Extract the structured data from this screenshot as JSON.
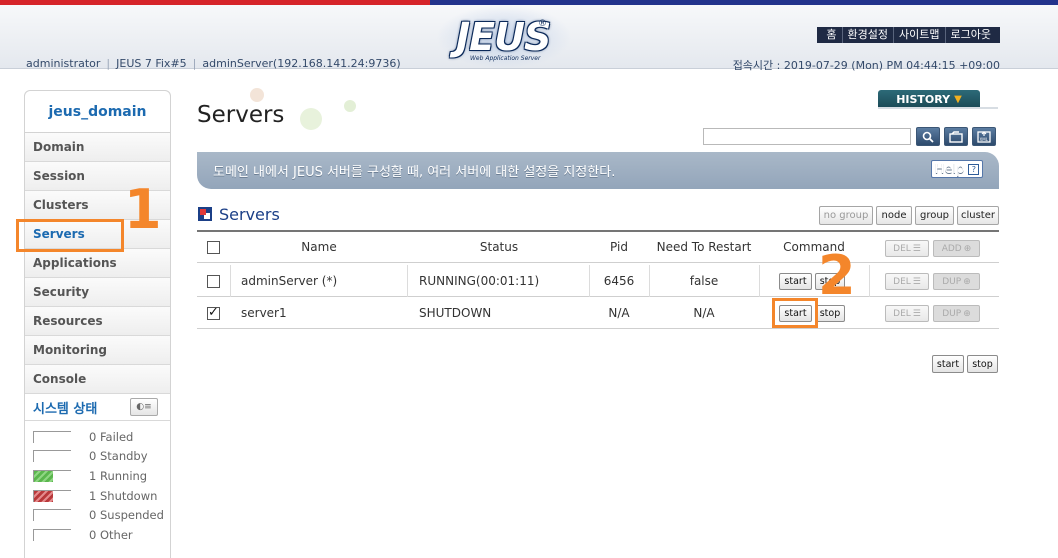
{
  "header": {
    "logo": "JEUS",
    "logo_subtitle": "Web Application Server",
    "nav": [
      "홈",
      "환경설정",
      "사이트맵",
      "로그아웃"
    ],
    "user": "administrator",
    "version": "JEUS 7 Fix#5",
    "server": "adminServer(192.168.141.24:9736)",
    "connection_time": "접속시간 : 2019-07-29 (Mon) PM 04:44:15 +09:00"
  },
  "sidebar": {
    "domain": "jeus_domain",
    "items": [
      "Domain",
      "Session",
      "Clusters",
      "Servers",
      "Applications",
      "Security",
      "Resources",
      "Monitoring",
      "Console"
    ],
    "active": "Servers",
    "system_status_title": "시스템 상태",
    "stats": [
      {
        "count": "0",
        "label": "Failed"
      },
      {
        "count": "0",
        "label": "Standby"
      },
      {
        "count": "1",
        "label": "Running"
      },
      {
        "count": "1",
        "label": "Shutdown"
      },
      {
        "count": "0",
        "label": "Suspended"
      },
      {
        "count": "0",
        "label": "Other"
      }
    ]
  },
  "main": {
    "title": "Servers",
    "history_label": "HISTORY",
    "search_placeholder": "",
    "description": "도메인 내에서 JEUS 서버를 구성할 때, 여러 서버에 대한 설정을 지정한다.",
    "help_label": "Help",
    "section_title": "Servers",
    "filters": [
      "no group",
      "node",
      "group",
      "cluster"
    ],
    "columns": [
      "Name",
      "Status",
      "Pid",
      "Need To Restart",
      "Command"
    ],
    "del_label": "DEL",
    "add_label": "ADD",
    "dup_label": "DUP",
    "start_label": "start",
    "stop_label": "stop",
    "rows": [
      {
        "checked": false,
        "name": "adminServer (*)",
        "status": "RUNNING(00:01:11)",
        "pid": "6456",
        "need_restart": "false"
      },
      {
        "checked": true,
        "name": "server1",
        "status": "SHUTDOWN",
        "pid": "N/A",
        "need_restart": "N/A"
      }
    ]
  },
  "annotations": {
    "one": "1",
    "two": "2",
    "color": "#f4862b"
  }
}
